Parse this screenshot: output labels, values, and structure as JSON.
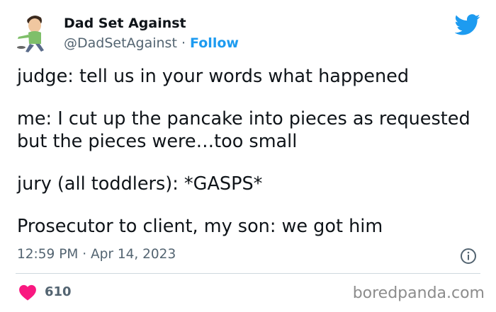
{
  "author": {
    "name": "Dad Set Against",
    "handle": "@DadSetAgainst",
    "separator": "·",
    "follow_label": "Follow"
  },
  "tweet": {
    "paragraphs": [
      "judge: tell us in your words what happened",
      "me: I cut up the pancake into pieces as requested\nbut the pieces were…too small",
      "jury (all toddlers): *GASPS*",
      "Prosecutor to client, my son: we got him"
    ],
    "timestamp": "12:59 PM · Apr 14, 2023"
  },
  "engagement": {
    "likes": "610"
  },
  "watermark": "boredpanda.com",
  "icons": {
    "logo": "twitter-bird-icon",
    "info": "info-icon",
    "like": "heart-icon"
  },
  "colors": {
    "brand": "#1d9bf0",
    "heart": "#f91880",
    "secondary_text": "#536471"
  }
}
